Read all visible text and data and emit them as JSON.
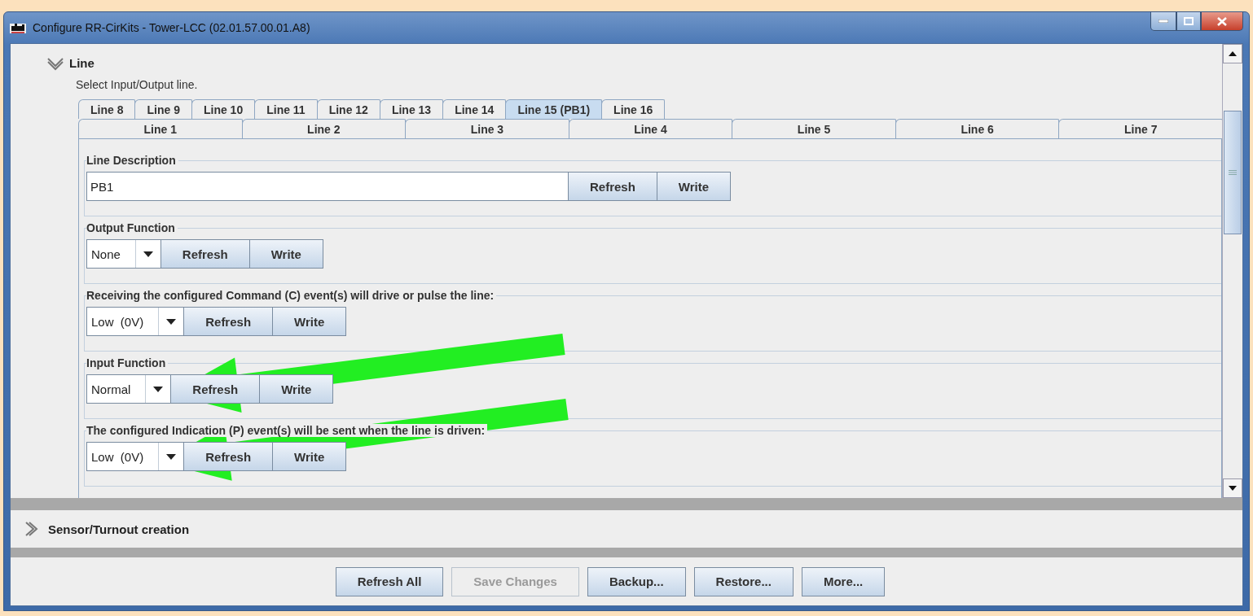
{
  "window": {
    "title": "Configure RR-CirKits - Tower-LCC (02.01.57.00.01.A8)"
  },
  "sections": [
    {
      "title": "Line",
      "expanded": true,
      "hint": "Select Input/Output line.",
      "tab_rows": [
        {
          "tabs": [
            {
              "label": "Line 8",
              "selected": false
            },
            {
              "label": "Line 9",
              "selected": false
            },
            {
              "label": "Line 10",
              "selected": false
            },
            {
              "label": "Line 11",
              "selected": false
            },
            {
              "label": "Line 12",
              "selected": false
            },
            {
              "label": "Line 13",
              "selected": false
            },
            {
              "label": "Line 14",
              "selected": false
            },
            {
              "label": "Line 15 (PB1)",
              "selected": true
            },
            {
              "label": "Line 16",
              "selected": false
            }
          ]
        },
        {
          "tabs": [
            {
              "label": "Line 1",
              "selected": false
            },
            {
              "label": "Line 2",
              "selected": false
            },
            {
              "label": "Line 3",
              "selected": false
            },
            {
              "label": "Line 4",
              "selected": false
            },
            {
              "label": "Line 5",
              "selected": false
            },
            {
              "label": "Line 6",
              "selected": false
            },
            {
              "label": "Line 7",
              "selected": false
            }
          ]
        }
      ],
      "groups": [
        {
          "kind": "text",
          "label": "Line Description",
          "value": "PB1",
          "buttons": [
            "Refresh",
            "Write"
          ]
        },
        {
          "kind": "select",
          "label": "Output Function",
          "value": "None",
          "buttons": [
            "Refresh",
            "Write"
          ]
        },
        {
          "kind": "select",
          "label": "Receiving the configured Command (C) event(s) will drive or pulse the line:",
          "value": "Low  (0V)",
          "buttons": [
            "Refresh",
            "Write"
          ]
        },
        {
          "kind": "select",
          "label": "Input Function",
          "value": "Normal",
          "buttons": [
            "Refresh",
            "Write"
          ]
        },
        {
          "kind": "select",
          "label": "The configured Indication (P) event(s) will be sent when the line is driven:",
          "value": "Low  (0V)",
          "buttons": [
            "Refresh",
            "Write"
          ]
        }
      ]
    },
    {
      "title": "Sensor/Turnout creation",
      "expanded": false
    }
  ],
  "footer_buttons": [
    {
      "label": "Refresh All",
      "disabled": false
    },
    {
      "label": "Save Changes",
      "disabled": true
    },
    {
      "label": "Backup...",
      "disabled": false
    },
    {
      "label": "Restore...",
      "disabled": false
    },
    {
      "label": "More...",
      "disabled": false
    }
  ]
}
